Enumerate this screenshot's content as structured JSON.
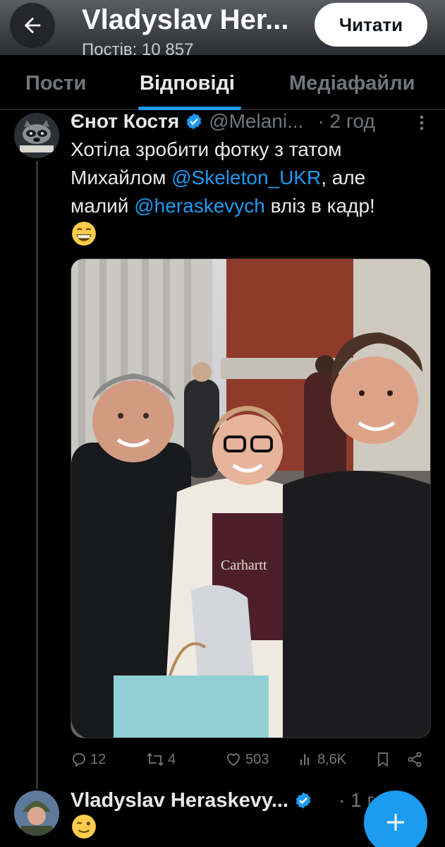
{
  "header": {
    "title": "Vladyslav Her...",
    "subtitle": "Постів: 10 857",
    "follow_label": "Читати"
  },
  "tabs": [
    {
      "label": "Пости",
      "active": false
    },
    {
      "label": "Відповіді",
      "active": true
    },
    {
      "label": "Медіафайли",
      "active": false
    }
  ],
  "tweet": {
    "author_name": "Єнот Костя",
    "handle": "@Melani...",
    "time": "· 2 год",
    "text_part1": "Хотіла зробити фотку з татом Михайлом ",
    "mention1": "@Skeleton_UKR",
    "text_part2": ", але малий ",
    "mention2": "@heraskevych",
    "text_part3": " вліз в кадр!",
    "stats": {
      "replies": "12",
      "reposts": "4",
      "likes": "503",
      "views": "8,6K"
    }
  },
  "next_tweet": {
    "author_name": "Vladyslav Heraskevy...",
    "time": "· 1 г"
  },
  "colors": {
    "accent": "#1d9bf0",
    "muted": "#71767b",
    "text": "#e7e9ea"
  }
}
